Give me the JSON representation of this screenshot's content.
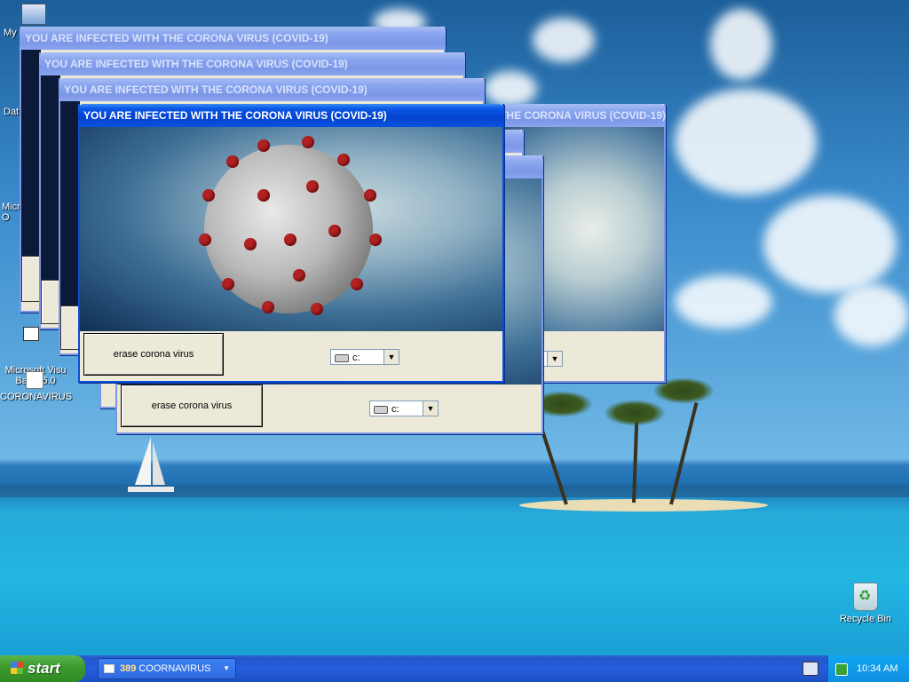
{
  "desktop": {
    "icons": [
      {
        "id": "my-computer",
        "label": "My"
      },
      {
        "id": "data",
        "label": "Dat"
      },
      {
        "id": "microsoft-office",
        "label": "Microsof\nO"
      },
      {
        "id": "vb6",
        "label": "Microsoft Visu\nBasic 6.0"
      },
      {
        "id": "coronavirus-folder",
        "label": "CORONAVIRUS"
      },
      {
        "id": "recycle-bin",
        "label": "Recycle Bin"
      }
    ]
  },
  "popup": {
    "title": "YOU ARE INFECTED WITH THE CORONA VIRUS (COVID-19)",
    "erase_label": "erase corona virus",
    "drive_value": "c:"
  },
  "taskbar": {
    "start_label": "start",
    "task_group_count": "389",
    "task_group_label": "COORNAVIRUS",
    "clock": "10:34 AM"
  },
  "colors": {
    "title_active": "#0a52de",
    "title_inactive": "#8aa4ee",
    "window_face": "#ece9d8",
    "start_green": "#3c9a2f",
    "taskbar_blue": "#245edb"
  }
}
